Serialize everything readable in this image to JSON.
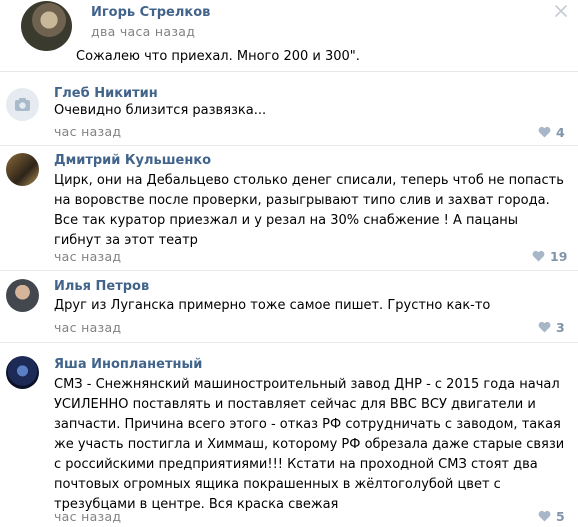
{
  "post": {
    "author": "Игорь Стрелков",
    "time": "два часа назад",
    "text": "Сожалею что  приехал. Много 200 и 300\"."
  },
  "comments": [
    {
      "author": "Глеб Никитин",
      "text": "Очевидно близится развязка...",
      "time": "час назад",
      "likes": "4",
      "avatar": "camera-placeholder"
    },
    {
      "author": "Дмитрий Кульшенко",
      "text": "Цирк, они на Дебальцево столько денег списали, теперь чтоб не попасть на воровстве после проверки, разыгрывают типо слив и захват города. Все так куратор приезжал и у резал на 30% снабжение ! А пацаны гибнут за этот театр",
      "time": "час назад",
      "likes": "19",
      "avatar": "photo"
    },
    {
      "author": "Илья Петров",
      "text": "Друг из Луганска примерно тоже самое пишет. Грустно как-то",
      "time": "час назад",
      "likes": "3",
      "avatar": "photo"
    },
    {
      "author": "Яша Инопланетный",
      "text": "СМЗ - Снежнянский машиностроительный завод ДНР - с 2015 года начал УСИЛЕННО поставлять и поставляет сейчас для ВВС ВСУ двигатели и запчасти. Причина всего этого - отказ РФ сотрудничать с заводом, такая же участь постигла и Химмаш, которому РФ обрезала даже старые связи с российскими предприятиями!!! Кстати на проходной СМЗ стоят два почтовых огромных ящика покрашенных в жёлтоголубой цвет с трезубцами в центре. Вся краска свежая",
      "time": "час назад",
      "likes": "5",
      "avatar": "photo"
    }
  ],
  "colors": {
    "author_link": "#42648b",
    "muted": "#828282",
    "like": "#8095aa",
    "separator": "#e7e8ec"
  }
}
